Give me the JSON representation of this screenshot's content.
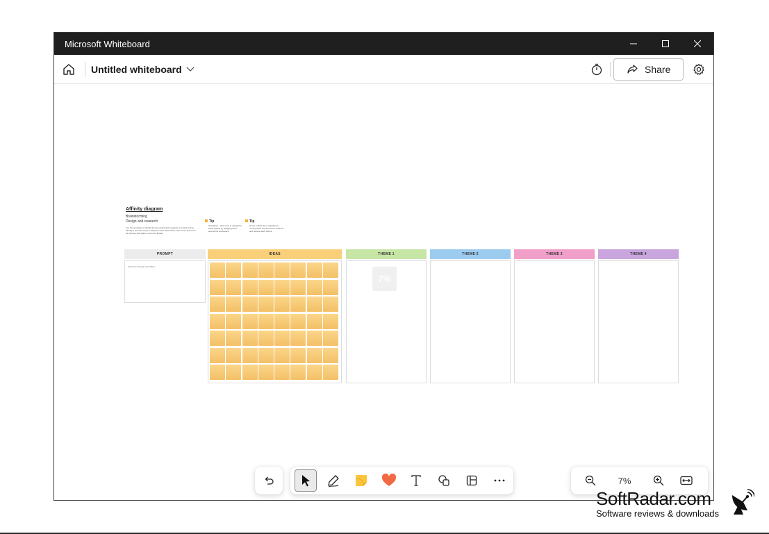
{
  "window": {
    "title": "Microsoft Whiteboard"
  },
  "header": {
    "doc_title": "Untitled whiteboard",
    "share_label": "Share"
  },
  "template": {
    "title": "Affinity diagram",
    "subtitle1": "Brainstorming",
    "subtitle2": "Design and research",
    "description": "Use this template to identify themes during data analysis or brainstorming. Identify a prompt, create a sticky for each observation, then move items into the themes that share a common thread.",
    "tips": [
      {
        "label": "Tip",
        "text": "Navigation · add notes to categorize ideas quickly by dragging them around the workspace"
      },
      {
        "label": "Tip",
        "text": "Group related items together by moving them into the theme columns and rename each theme."
      }
    ],
    "prompt_hint": "Introduce the goal or problem",
    "columns": [
      {
        "label": "PROMPT",
        "color": "#ececec"
      },
      {
        "label": "IDEAS",
        "color": "#f9cf7a"
      },
      {
        "label": "THEME 1",
        "color": "#c7e6a6"
      },
      {
        "label": "THEME 2",
        "color": "#9ccbf0"
      },
      {
        "label": "THEME 3",
        "color": "#f0a0c8"
      },
      {
        "label": "THEME 4",
        "color": "#c9a5de"
      }
    ],
    "ghost_note": "7%"
  },
  "zoom": {
    "level": "7%"
  },
  "watermark": {
    "title": "SoftRadar.com",
    "subtitle": "Software reviews & downloads"
  },
  "icons": {
    "home": "home-icon",
    "chevron": "chevron-down-icon",
    "timer": "timer-icon",
    "share": "share-icon",
    "settings": "gear-icon",
    "undo": "undo-icon",
    "select": "cursor-icon",
    "pen": "pen-icon",
    "sticky": "sticky-note-icon",
    "reaction": "heart-icon",
    "text": "text-icon",
    "shapes": "shapes-icon",
    "templates": "templates-icon",
    "more": "more-icon",
    "zoom_out": "zoom-out-icon",
    "zoom_in": "zoom-in-icon",
    "fit": "fit-to-screen-icon"
  },
  "colors": {
    "titlebar": "#1f1f1f",
    "sticky": "#f6c870",
    "heart": "#f06a44"
  }
}
